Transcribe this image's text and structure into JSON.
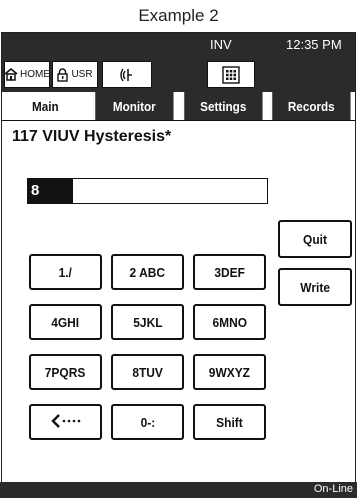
{
  "caption": "Example 2",
  "status": {
    "mode": "INV",
    "time": "12:35 PM",
    "home_label": "HOME",
    "user_label": "USR"
  },
  "tabs": [
    {
      "label": "Main",
      "active": true
    },
    {
      "label": "Monitor",
      "active": false
    },
    {
      "label": "Settings",
      "active": false
    },
    {
      "label": "Records",
      "active": false
    }
  ],
  "parameter": {
    "title": "117  VIUV Hysteresis*",
    "value": "8"
  },
  "keypad": {
    "k1": "1./",
    "k2": "2 ABC",
    "k3": "3DEF",
    "k4": "4GHI",
    "k5": "5JKL",
    "k6": "6MNO",
    "k7": "7PQRS",
    "k8": "8TUV",
    "k9": "9WXYZ",
    "k0": "0-:",
    "shift": "Shift",
    "backspace_icon": "backspace-arrow-icon"
  },
  "actions": {
    "quit": "Quit",
    "write": "Write"
  },
  "footer": {
    "connection": "On-Line"
  },
  "colors": {
    "bar": "#2b2b2b",
    "background": "#ffffff",
    "text": "#111111"
  }
}
